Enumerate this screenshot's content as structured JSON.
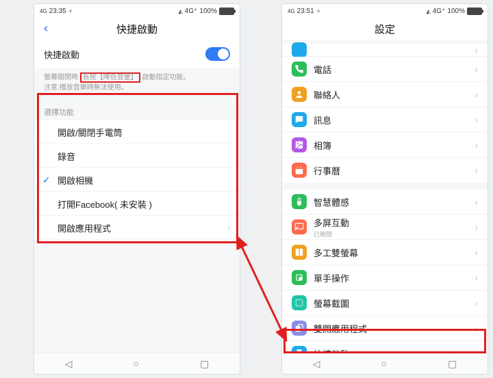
{
  "left": {
    "status": {
      "time": "23:35",
      "net_small": "4G",
      "net": "4G⁺",
      "batt": "100%"
    },
    "header": {
      "title": "快捷啟動"
    },
    "toggle": {
      "label": "快捷啟動"
    },
    "desc": {
      "prefix": "螢幕關閉時 ",
      "highlight": "長按【降低音量】",
      "suffix": " 啟動指定功能。",
      "note": "注意:播放音樂時無法使用。"
    },
    "group_label": "選擇功能",
    "funcs": [
      {
        "label": "開啟/關閉手電筒",
        "check": false,
        "chev": false
      },
      {
        "label": "錄音",
        "check": false,
        "chev": false
      },
      {
        "label": "開啟相機",
        "check": true,
        "chev": false
      },
      {
        "label": "打開Facebook( 未安裝 )",
        "check": false,
        "chev": false
      },
      {
        "label": "開啟應用程式",
        "check": false,
        "chev": true
      }
    ]
  },
  "right": {
    "status": {
      "time": "23:51",
      "net_small": "4G",
      "net": "4G⁺",
      "batt": "100%"
    },
    "header": {
      "title": "設定"
    },
    "items": [
      {
        "label": "電話",
        "icon": "phone",
        "color": "#2dbd5a"
      },
      {
        "label": "聯絡人",
        "icon": "contacts",
        "color": "#f0a020"
      },
      {
        "label": "訊息",
        "icon": "message",
        "color": "#1fa9ea"
      },
      {
        "label": "相簿",
        "icon": "gallery",
        "color": "#b25ae6"
      },
      {
        "label": "行事曆",
        "icon": "calendar",
        "color": "#ff6a4d"
      }
    ],
    "items2": [
      {
        "label": "智慧體感",
        "icon": "gesture",
        "color": "#2dbd5a"
      },
      {
        "label": "多屏互動",
        "sub": "已關閉",
        "icon": "cast",
        "color": "#ff6a4d"
      },
      {
        "label": "多工雙螢幕",
        "icon": "split",
        "color": "#f0a020"
      },
      {
        "label": "單手操作",
        "icon": "onehand",
        "color": "#2dbd5a"
      },
      {
        "label": "螢幕截圖",
        "icon": "screenshot",
        "color": "#20c6a6"
      },
      {
        "label": "雙開應用程式",
        "icon": "clone",
        "color": "#8a8fe6"
      },
      {
        "label": "快捷啟動",
        "icon": "quick",
        "color": "#1fa9ea"
      }
    ]
  },
  "sysbar": {
    "back": "◁",
    "home": "○",
    "recent": "▢"
  }
}
